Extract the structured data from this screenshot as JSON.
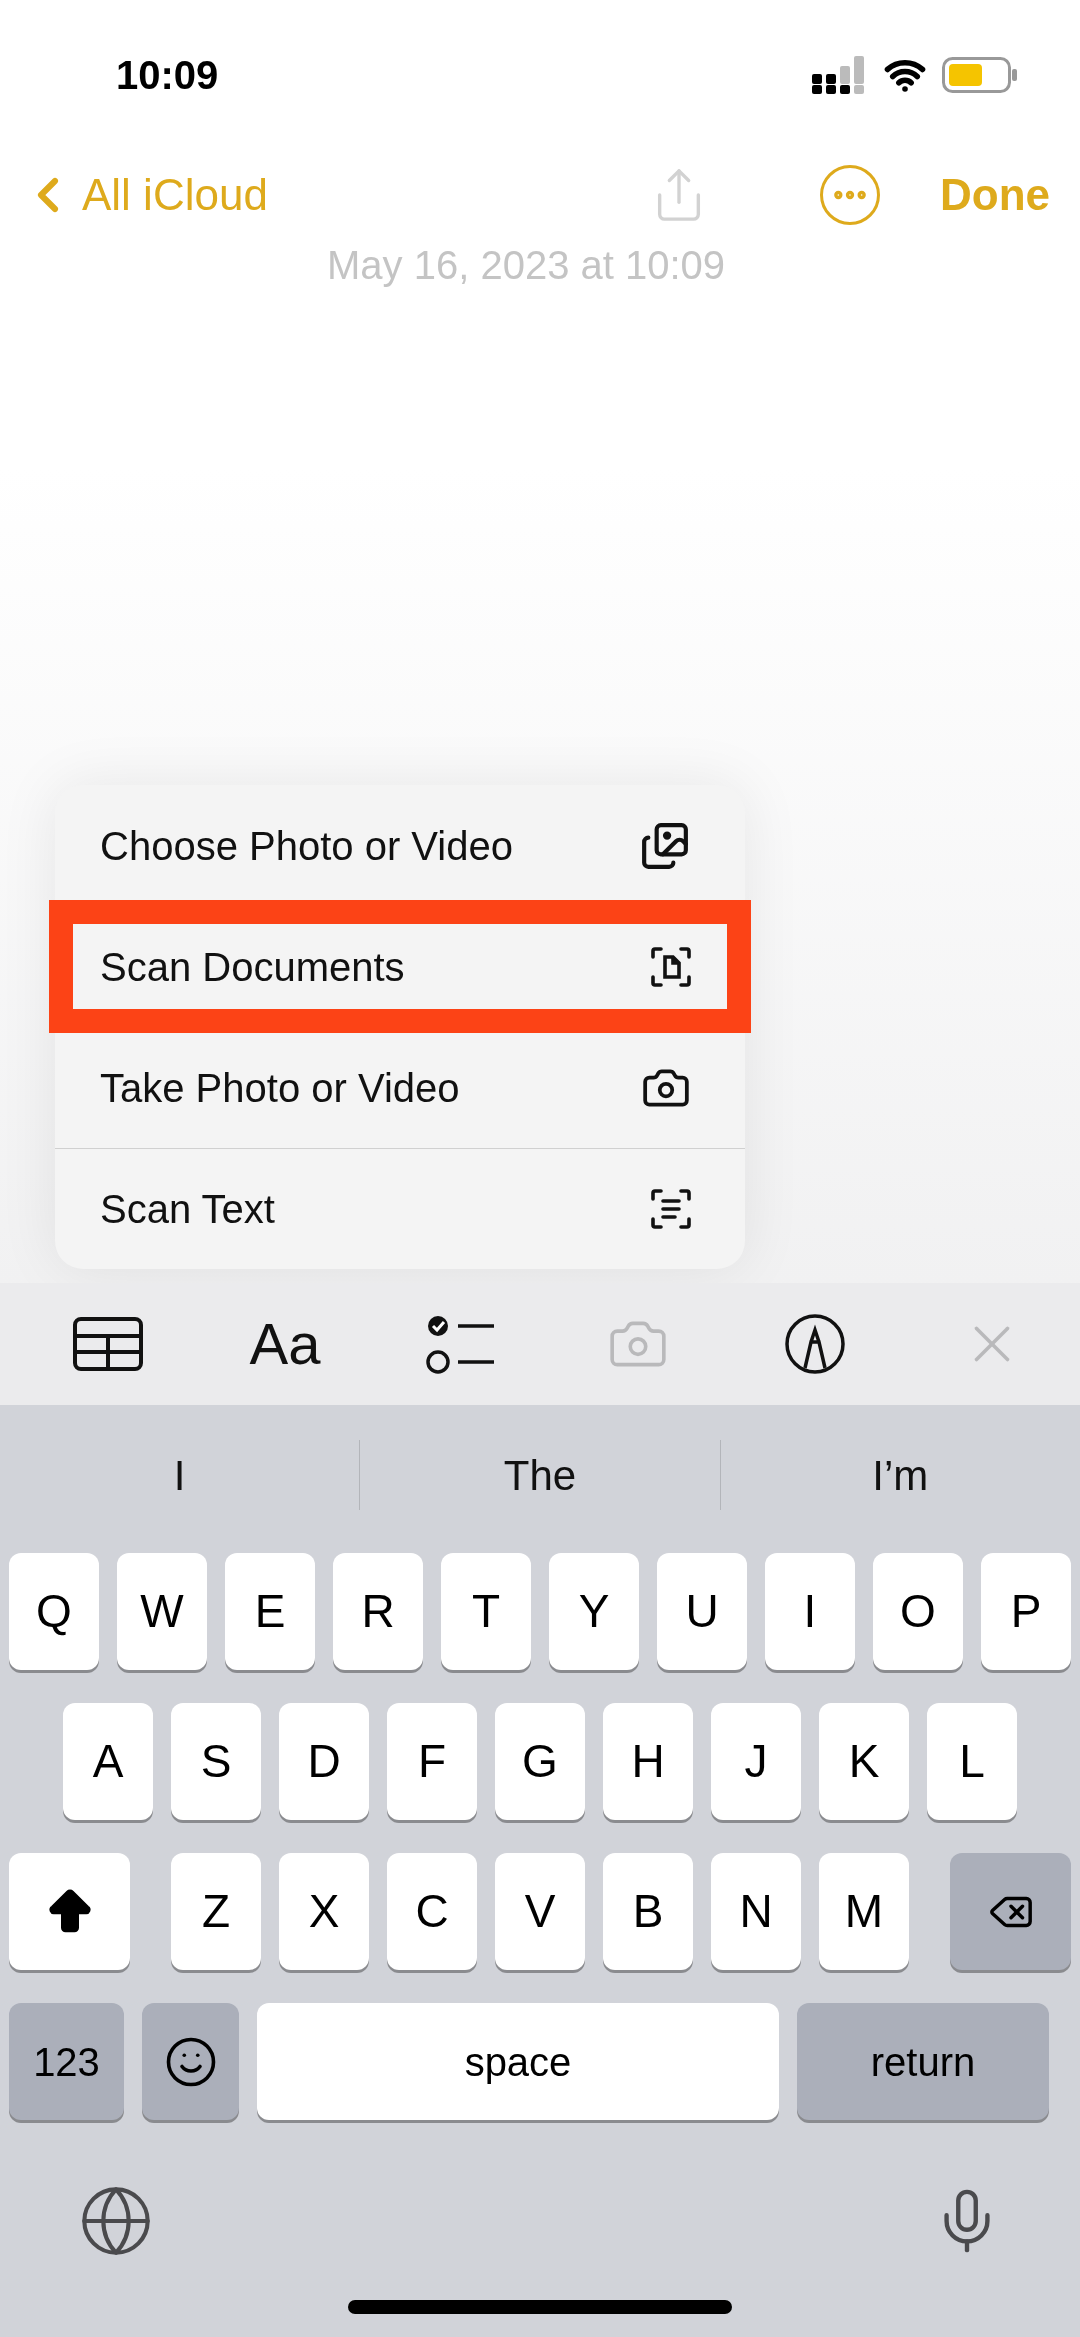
{
  "status_bar": {
    "time": "10:09"
  },
  "nav": {
    "back_label": "All iCloud",
    "done_label": "Done",
    "date": "May 16, 2023 at 10:09"
  },
  "menu": [
    {
      "label": "Choose Photo or Video",
      "kind": "photos",
      "highlighted": false
    },
    {
      "label": "Scan Documents",
      "kind": "scan_doc",
      "highlighted": true
    },
    {
      "label": "Take Photo or Video",
      "kind": "camera",
      "highlighted": false
    },
    {
      "label": "Scan Text",
      "kind": "scan_text",
      "highlighted": false
    }
  ],
  "toolbar": [
    {
      "kind": "table",
      "disabled": false
    },
    {
      "kind": "format",
      "label": "Aa",
      "disabled": false
    },
    {
      "kind": "checklist",
      "disabled": false
    },
    {
      "kind": "camera",
      "disabled": true
    },
    {
      "kind": "markup",
      "disabled": false
    },
    {
      "kind": "close",
      "disabled": true
    }
  ],
  "suggestions": [
    "I",
    "The",
    "I’m"
  ],
  "keyboard": {
    "shift_on": true,
    "rows": [
      [
        "Q",
        "W",
        "E",
        "R",
        "T",
        "Y",
        "U",
        "I",
        "O",
        "P"
      ],
      [
        "A",
        "S",
        "D",
        "F",
        "G",
        "H",
        "J",
        "K",
        "L"
      ],
      [
        "Z",
        "X",
        "C",
        "V",
        "B",
        "N",
        "M"
      ]
    ],
    "numbers_label": "123",
    "space_label": "space",
    "return_label": "return"
  }
}
